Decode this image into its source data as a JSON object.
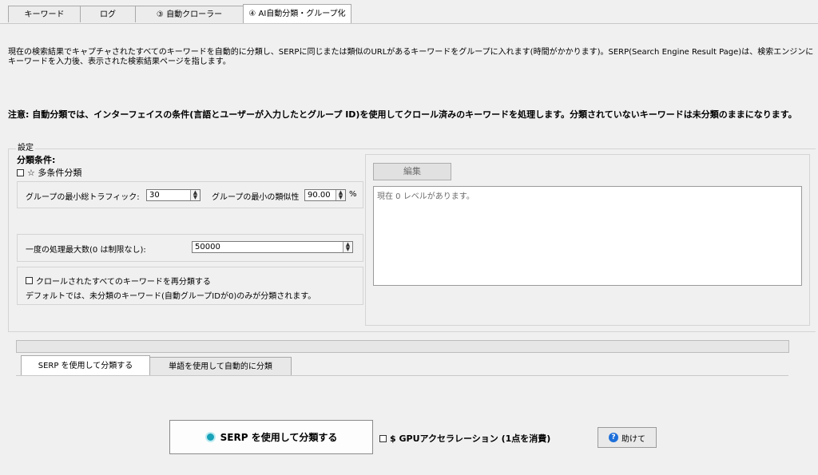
{
  "tabs": [
    {
      "label": "キーワード"
    },
    {
      "label": "ログ"
    },
    {
      "label": "③ 自動クローラー"
    },
    {
      "label": "④ AI自動分類・グループ化"
    }
  ],
  "description": "現在の検索結果でキャプチャされたすべてのキーワードを自動的に分類し、SERPに同じまたは類似のURLがあるキーワードをグループに入れます(時間がかかります)。SERP(Search Engine Result Page)は、検索エンジンにキーワードを入力後、表示された検索結果ページを指します。",
  "note": "注意: 自動分類では、インターフェイスの条件(言語とユーザーが入力したとグループ ID)を使用してクロール済みのキーワードを処理します。分類されていないキーワードは未分類のままになります。",
  "settings": {
    "title": "設定",
    "conditions_label": "分類条件:",
    "multi_condition_label": "☆ 多条件分類",
    "min_traffic_label": "グループの最小総トラフィック:",
    "min_traffic_value": "30",
    "min_similarity_label": "グループの最小の類似性",
    "min_similarity_value": "90.00",
    "percent": "%",
    "max_process_label": "一度の処理最大数(0 は制限なし):",
    "max_process_value": "50000",
    "reclassify_label": "クロールされたすべてのキーワードを再分類する",
    "default_note": "デフォルトでは、未分類のキーワード(自動グループIDが0)のみが分類されます。",
    "edit_button": "編集",
    "levels_text": "現在 0 レベルがあります。"
  },
  "bottom_tabs": [
    {
      "label": "SERP を使用して分類する"
    },
    {
      "label": "単語を使用して自動的に分類"
    }
  ],
  "actions": {
    "classify_button": "SERP を使用して分類する",
    "gpu_label": "$ GPUアクセラレーション (1点を消費)",
    "help_button": "助けて"
  },
  "colors": {
    "accent": "#17a2b8",
    "help_icon": "#1e6fd9"
  }
}
